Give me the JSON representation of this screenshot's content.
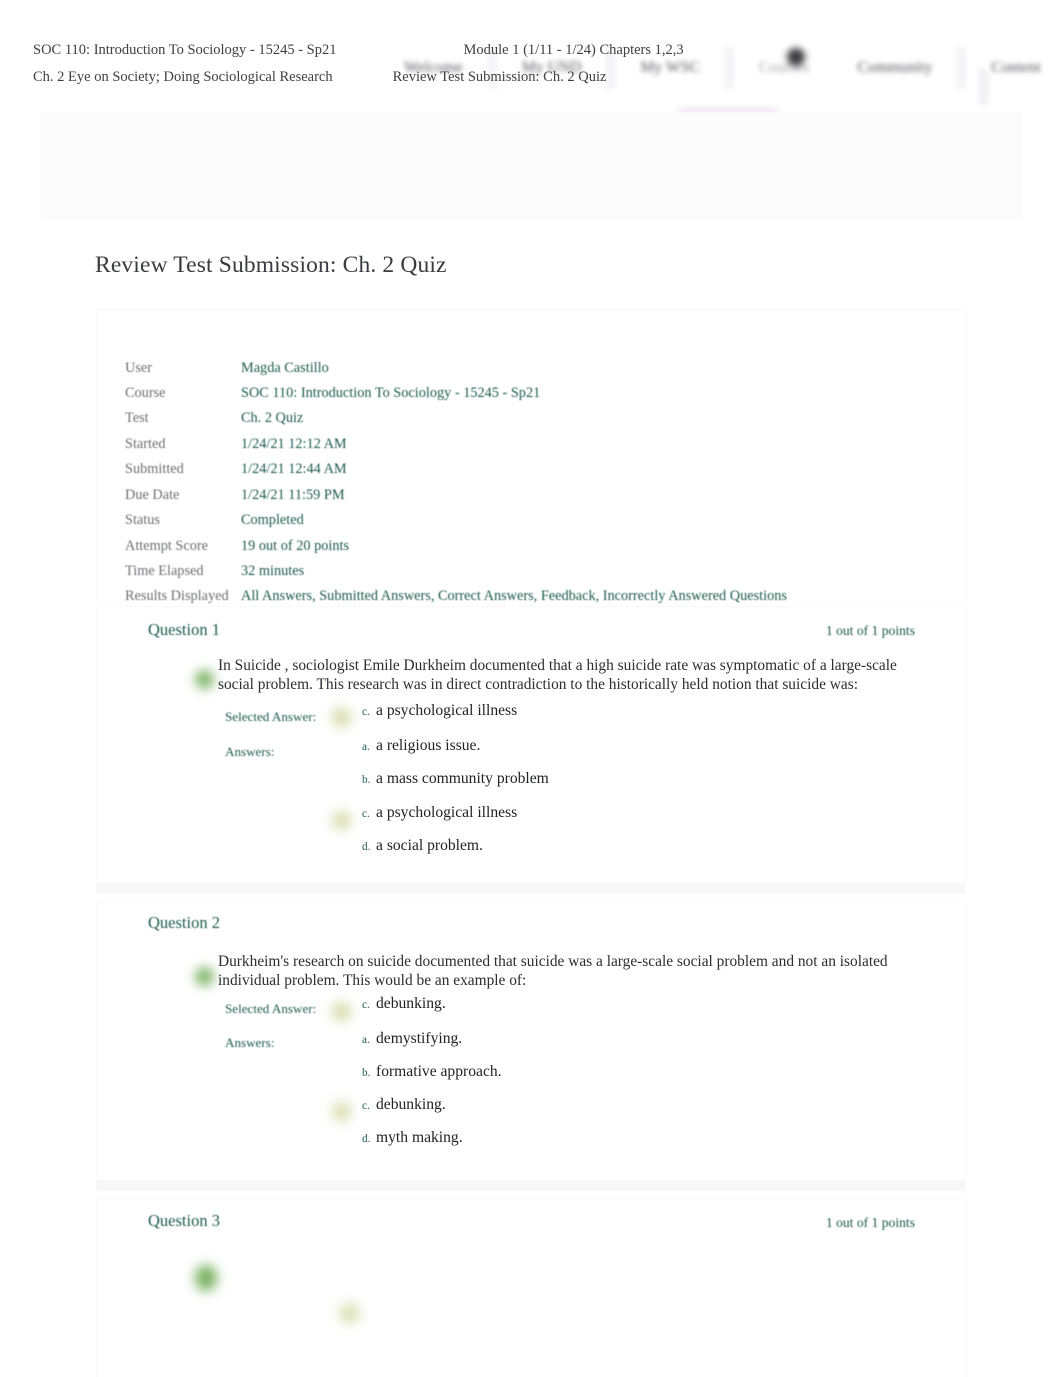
{
  "nav": {
    "tabs": [
      {
        "label": "Welcome",
        "active": false
      },
      {
        "label": "My UND",
        "active": false
      },
      {
        "label": "My WSC",
        "active": false
      },
      {
        "label": "Courses",
        "active": true
      },
      {
        "label": "Community",
        "active": false
      },
      {
        "label": "Content",
        "active": false
      }
    ],
    "accent_highlight": "#f0dff0"
  },
  "breadcrumb": {
    "row1": [
      "SOC 110: Introduction To Sociology - 15245 - Sp21",
      "Module 1 (1/11 - 1/24) Chapters 1,2,3"
    ],
    "row2": [
      "Ch. 2 Eye on Society; Doing Sociological Research",
      "Review Test Submission: Ch. 2 Quiz"
    ]
  },
  "page": {
    "title": "Review Test Submission: Ch. 2 Quiz",
    "accent_color": "#1d5c4d"
  },
  "info": {
    "rows": [
      {
        "label": "User",
        "value": "Magda Castillo"
      },
      {
        "label": "Course",
        "value": "SOC 110: Introduction To Sociology - 15245 - Sp21"
      },
      {
        "label": "Test",
        "value": "Ch. 2 Quiz"
      },
      {
        "label": "Started",
        "value": "1/24/21 12:12 AM"
      },
      {
        "label": "Submitted",
        "value": "1/24/21 12:44 AM"
      },
      {
        "label": "Due Date",
        "value": "1/24/21 11:59 PM"
      },
      {
        "label": "Status",
        "value": "Completed"
      },
      {
        "label": "Attempt Score",
        "value": "19 out of 20 points"
      },
      {
        "label": "Time Elapsed",
        "value": "32 minutes"
      },
      {
        "label": "Results Displayed",
        "value": "All Answers, Submitted Answers, Correct Answers, Feedback, Incorrectly Answered Questions"
      }
    ]
  },
  "questions": [
    {
      "heading": "Question 1",
      "points": "1 out of 1 points",
      "text": "In Suicide , sociologist Emile Durkheim documented that a high suicide rate was symptomatic of a large-scale social problem. This research was in direct contradiction to the historically held notion that suicide was:",
      "selected_answer_label": "Selected Answer:",
      "answers_label": "Answers:",
      "selected": {
        "letter": "c.",
        "text": "a psychological illness"
      },
      "options": [
        {
          "letter": "a.",
          "text": "a religious issue.",
          "correct": false
        },
        {
          "letter": "b.",
          "text": "a mass community problem",
          "correct": false
        },
        {
          "letter": "c.",
          "text": "a psychological illness",
          "correct": true
        },
        {
          "letter": "d.",
          "text": "a social problem.",
          "correct": false
        }
      ]
    },
    {
      "heading": "Question 2",
      "points": "",
      "text": "Durkheim's research on suicide documented that suicide was a large-scale social problem and not an isolated individual problem. This would be an example of:",
      "selected_answer_label": "Selected Answer:",
      "answers_label": "Answers:",
      "selected": {
        "letter": "c.",
        "text": "debunking."
      },
      "options": [
        {
          "letter": "a.",
          "text": "demystifying.",
          "correct": false
        },
        {
          "letter": "b.",
          "text": "formative approach.",
          "correct": false
        },
        {
          "letter": "c.",
          "text": "debunking.",
          "correct": true
        },
        {
          "letter": "d.",
          "text": "myth making.",
          "correct": false
        }
      ]
    },
    {
      "heading": "Question 3",
      "points": "1 out of 1 points",
      "text": "",
      "selected_answer_label": "",
      "answers_label": "",
      "selected": {
        "letter": "",
        "text": ""
      },
      "options": []
    }
  ]
}
